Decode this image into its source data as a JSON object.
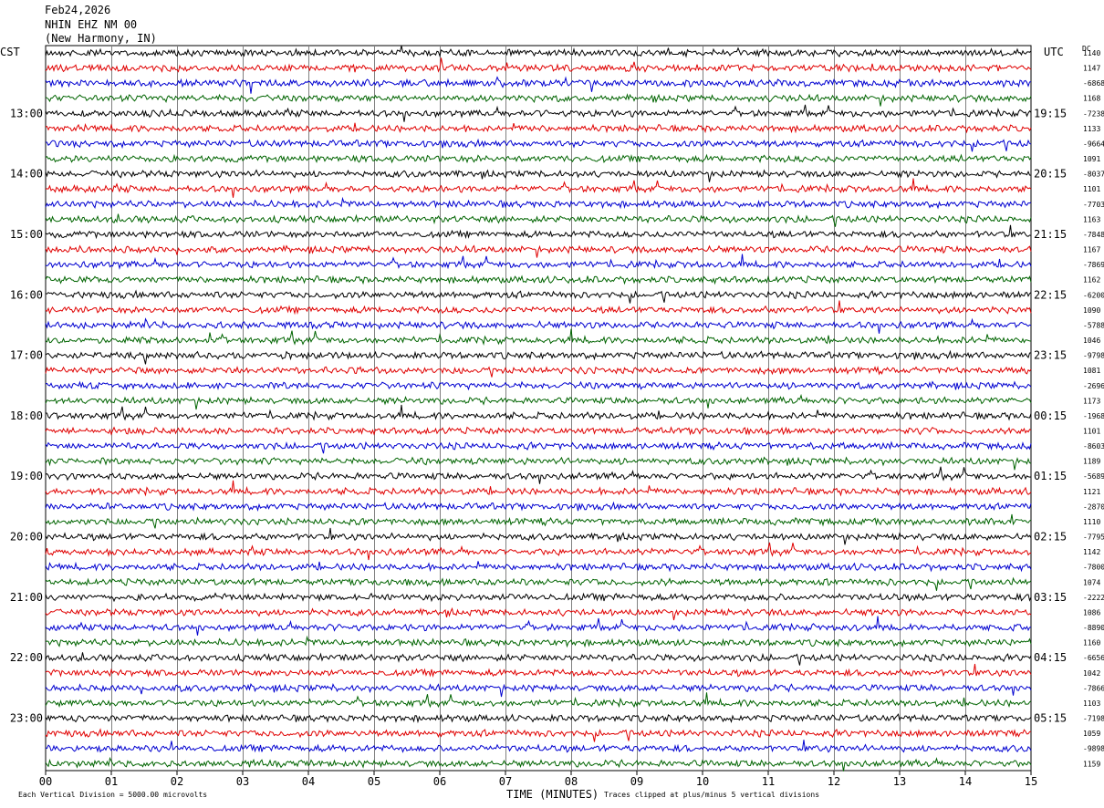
{
  "header": {
    "date": "Feb24,2026",
    "station": "NHIN EHZ NM 00",
    "location": "(New Harmony, IN)"
  },
  "left_zone": "CST",
  "right_zone": "UTC",
  "dc_heading": "DC",
  "footer": {
    "scale_note": "Each Vertical Division = 5000.00 microvolts",
    "clip_note": "Traces clipped at plus/minus 5 vertical divisions",
    "x_title": "TIME (MINUTES)"
  },
  "colors": {
    "trace_cycle": [
      "#000000",
      "#e00000",
      "#0000d0",
      "#006400"
    ],
    "grid": "#808080",
    "background": "#ffffff"
  },
  "chart_data": {
    "type": "line",
    "title": "",
    "xlabel": "TIME (MINUTES)",
    "ylabel": "",
    "xlim": [
      0,
      15
    ],
    "x_ticks": [
      "00",
      "01",
      "02",
      "03",
      "04",
      "05",
      "06",
      "07",
      "08",
      "09",
      "10",
      "11",
      "12",
      "13",
      "14",
      "15"
    ],
    "left_hour_labels": [
      "13:00",
      "14:00",
      "15:00",
      "16:00",
      "17:00",
      "18:00",
      "19:00",
      "20:00",
      "21:00",
      "22:00",
      "23:00"
    ],
    "right_hour_labels": [
      "19:15",
      "20:15",
      "21:15",
      "22:15",
      "23:15",
      "00:15",
      "01:15",
      "02:15",
      "03:15",
      "04:15",
      "05:15"
    ],
    "lines_per_hour": 4,
    "first_hour_line_index": 4,
    "num_traces": 48,
    "dc_offsets": [
      "1140",
      "1147",
      "-6868",
      "1168",
      "-7238",
      "1133",
      "-9664",
      "1091",
      "-8037",
      "1101",
      "-7703",
      "1163",
      "-7848",
      "1167",
      "-7869",
      "1162",
      "-6200",
      "1090",
      "-5788",
      "1046",
      "-9798",
      "1081",
      "-2696",
      "1173",
      "-1968",
      "1101",
      "-8603",
      "1189",
      "-5689",
      "1121",
      "-2870",
      "1110",
      "-7795",
      "1142",
      "-7800",
      "1074",
      "-2222",
      "1086",
      "-8890",
      "1160",
      "-6656",
      "1042",
      "-7866",
      "1103",
      "-7198",
      "1059",
      "-9898",
      "1159"
    ]
  }
}
